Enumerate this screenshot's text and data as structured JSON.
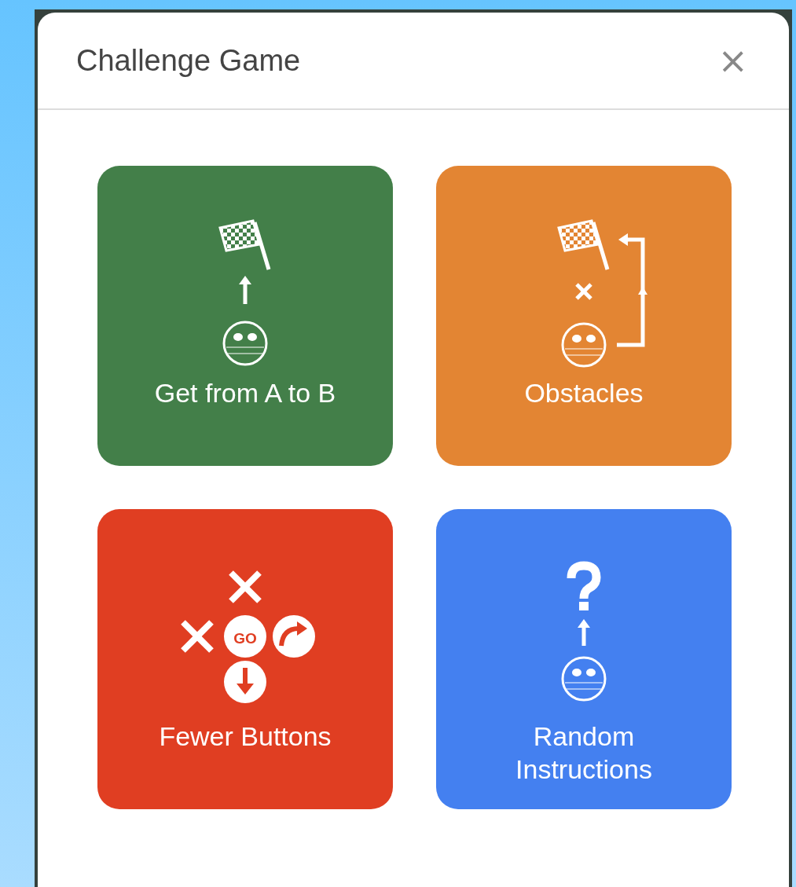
{
  "dialog": {
    "title": "Challenge Game",
    "close_label": "×"
  },
  "options": [
    {
      "label": "Get from A to B",
      "color": "#437f49",
      "kind": "reach"
    },
    {
      "label": "Obstacles",
      "color": "#e38533",
      "kind": "obstacles"
    },
    {
      "label": "Fewer Buttons",
      "color": "#e03e22",
      "kind": "fewer",
      "badge": "GO"
    },
    {
      "label": "Random Instructions",
      "color": "#4480f0",
      "kind": "random"
    }
  ]
}
